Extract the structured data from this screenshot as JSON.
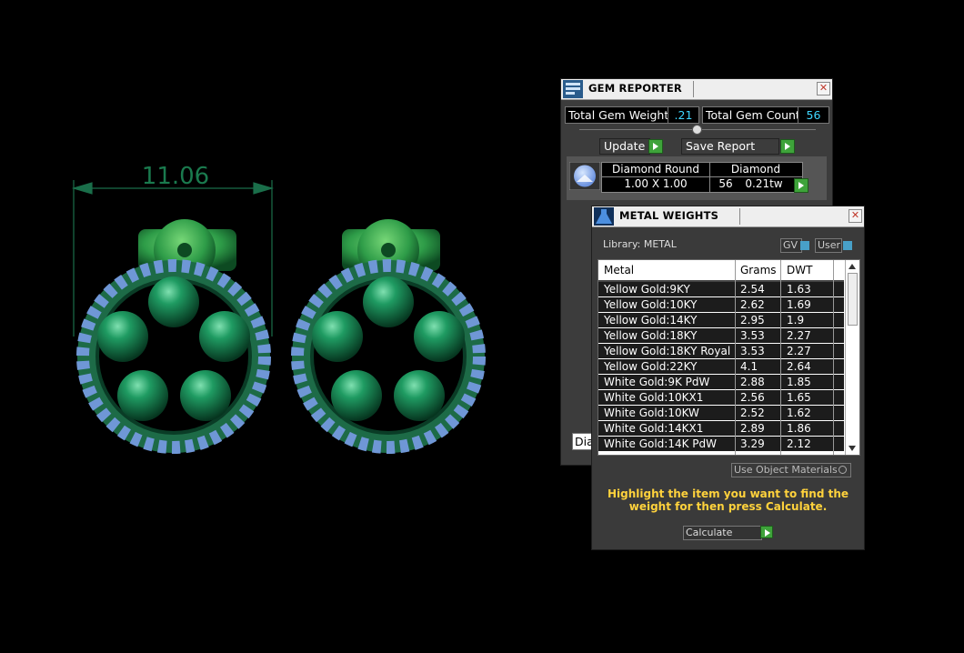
{
  "viewport": {
    "dimension_label": "11.06"
  },
  "gem_reporter": {
    "title": "GEM REPORTER",
    "total_gem_weight_label": "Total Gem Weight",
    "total_gem_weight_value": ".21",
    "total_gem_count_label": "Total Gem Count",
    "total_gem_count_value": "56",
    "update_label": "Update",
    "save_report_label": "Save Report",
    "gem": {
      "name": "Diamond Round",
      "size": "1.00 X 1.00",
      "type": "Diamond",
      "count": "56",
      "weight": "0.21tw"
    },
    "partial_label": "Dia"
  },
  "metal_weights": {
    "title": "METAL WEIGHTS",
    "library_label": "Library: METAL",
    "gv_label": "GV",
    "user_label": "User",
    "columns": [
      "Metal",
      "Grams",
      "DWT"
    ],
    "rows": [
      {
        "metal": "Yellow Gold:9KY",
        "grams": "2.54",
        "dwt": "1.63"
      },
      {
        "metal": "Yellow Gold:10KY",
        "grams": "2.62",
        "dwt": "1.69"
      },
      {
        "metal": "Yellow Gold:14KY",
        "grams": "2.95",
        "dwt": "1.9"
      },
      {
        "metal": "Yellow Gold:18KY",
        "grams": "3.53",
        "dwt": "2.27"
      },
      {
        "metal": "Yellow Gold:18KY Royal",
        "grams": "3.53",
        "dwt": "2.27"
      },
      {
        "metal": "Yellow Gold:22KY",
        "grams": "4.1",
        "dwt": "2.64"
      },
      {
        "metal": "White Gold:9K PdW",
        "grams": "2.88",
        "dwt": "1.85"
      },
      {
        "metal": "White Gold:10KX1",
        "grams": "2.56",
        "dwt": "1.65"
      },
      {
        "metal": "White Gold:10KW",
        "grams": "2.52",
        "dwt": "1.62"
      },
      {
        "metal": "White Gold:14KX1",
        "grams": "2.89",
        "dwt": "1.86"
      },
      {
        "metal": "White Gold:14K PdW",
        "grams": "3.29",
        "dwt": "2.12"
      }
    ],
    "use_object_materials_label": "Use Object Materials",
    "instruction": "Highlight the item you want to find the weight for then press Calculate.",
    "calculate_label": "Calculate"
  },
  "colors": {
    "earring_green": "#1f7a4a",
    "gem_blue": "#8fb7f0",
    "instruction_yellow": "#ffd23c",
    "value_cyan": "#3fd6ff",
    "go_green": "#3ea33a"
  }
}
